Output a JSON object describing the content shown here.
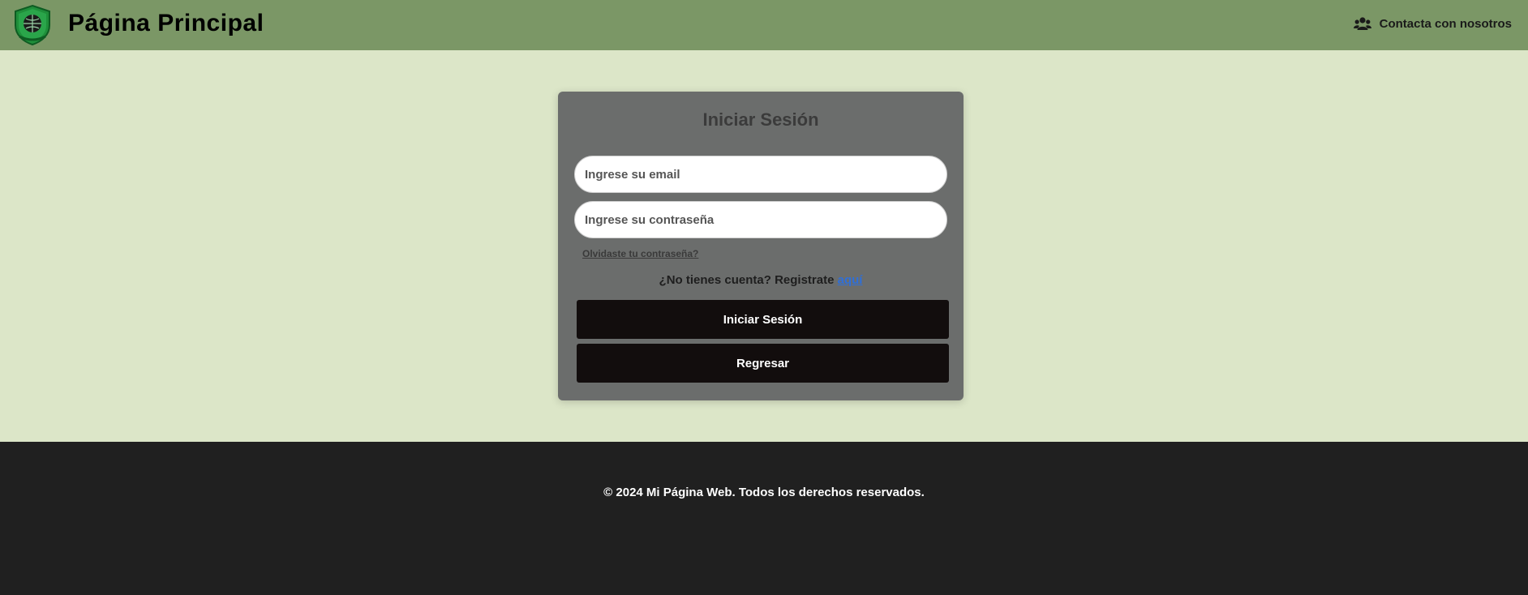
{
  "header": {
    "title": "Página Principal",
    "logo_icon": "shield-globe-logo",
    "contact_label": "Contacta con nosotros",
    "contact_icon": "users-icon",
    "background_color": "#7b9766"
  },
  "login": {
    "title": "Iniciar Sesión",
    "email_placeholder": "Ingrese su email",
    "password_placeholder": "Ingrese su contraseña",
    "forgot_label": "Olvidaste tu contraseña?",
    "register_text": "¿No tienes cuenta? Registrate",
    "register_link": "aquí",
    "login_button": "Iniciar Sesión",
    "back_button": "Regresar"
  },
  "footer": {
    "text": "© 2024 Mi Página Web. Todos los derechos reservados."
  },
  "colors": {
    "page_background": "#dce6c8",
    "card_background": "#6b6d6c",
    "button_background": "#120d0d",
    "footer_background": "#202020",
    "link": "#2f6fd8"
  }
}
